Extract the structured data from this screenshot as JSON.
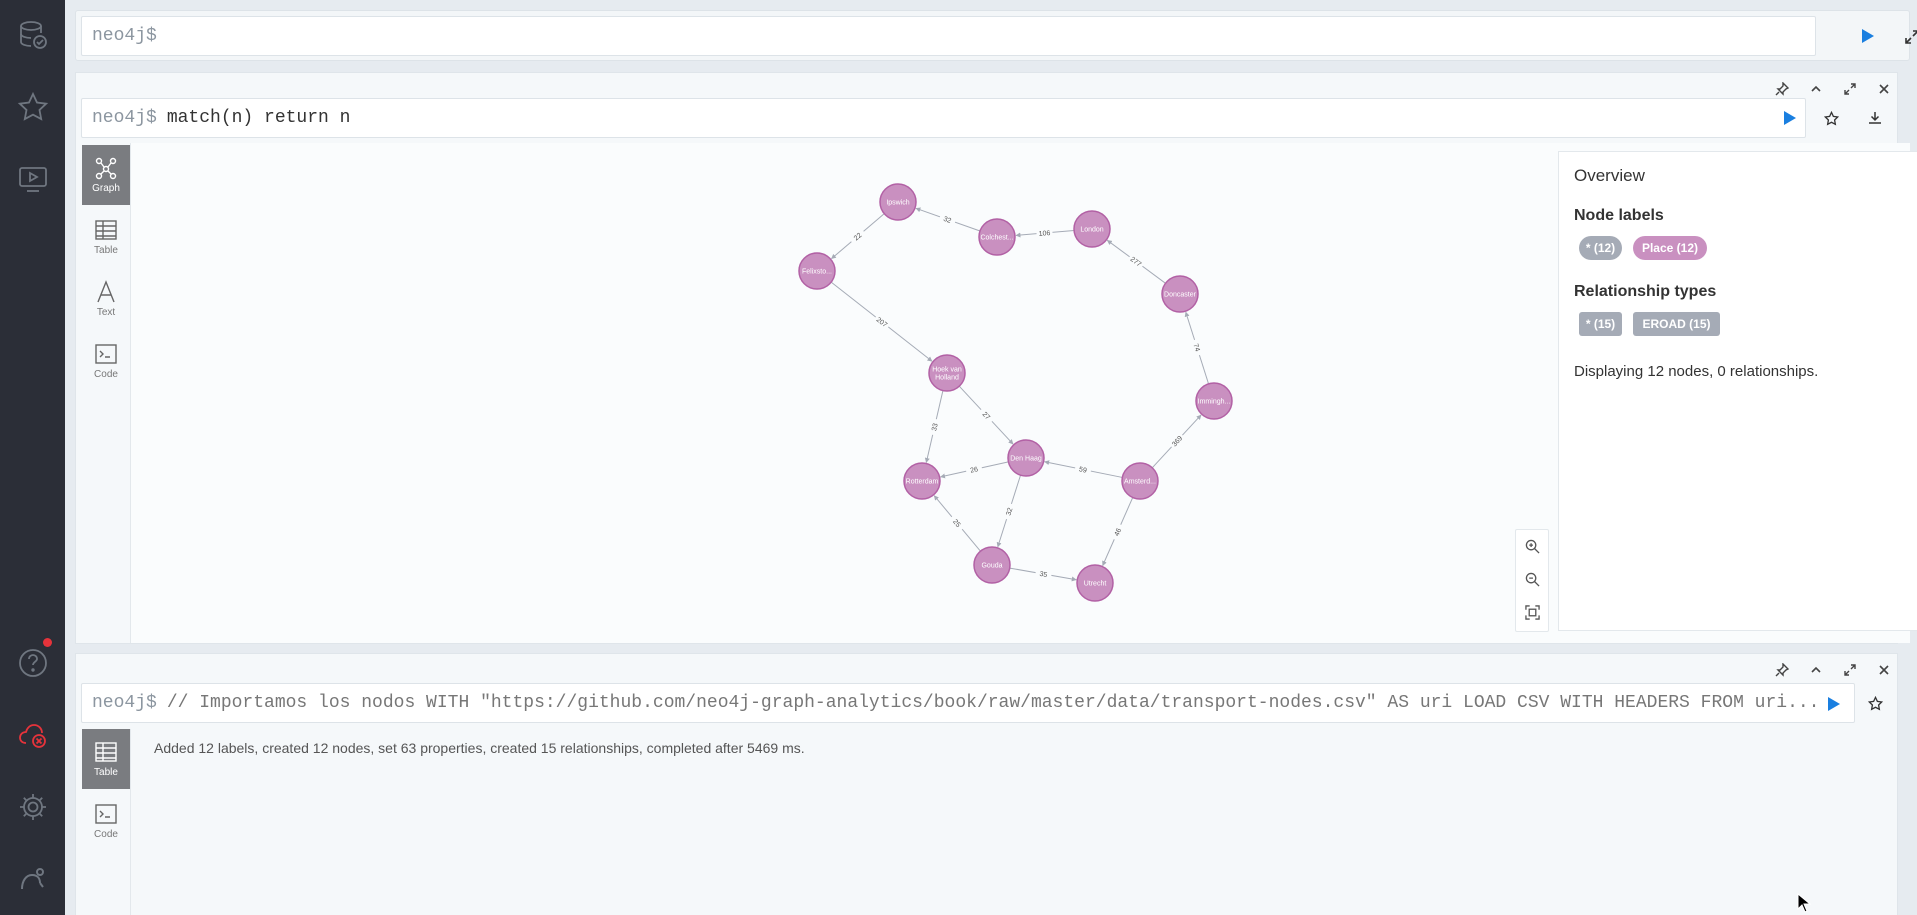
{
  "topbar": {
    "prompt": "neo4j$",
    "query": ""
  },
  "frame1": {
    "prompt": "neo4j$",
    "query": "match(n) return n",
    "tabs": [
      {
        "label": "Graph",
        "icon": "graph-icon",
        "active": true
      },
      {
        "label": "Table",
        "icon": "table-icon",
        "active": false
      },
      {
        "label": "Text",
        "icon": "text-icon",
        "active": false
      },
      {
        "label": "Code",
        "icon": "code-icon",
        "active": false
      }
    ],
    "overview": {
      "title": "Overview",
      "node_labels_title": "Node labels",
      "node_labels": [
        "* (12)",
        "Place (12)"
      ],
      "rel_types_title": "Relationship types",
      "rel_types": [
        "* (15)",
        "EROAD (15)"
      ],
      "status": "Displaying 12 nodes, 0 relationships."
    },
    "graph": {
      "nodes": [
        {
          "id": "ipswich",
          "label": "Ipswich"
        },
        {
          "id": "colchester",
          "label": "Colchest..."
        },
        {
          "id": "london",
          "label": "London"
        },
        {
          "id": "felixstowe",
          "label": "Felixsto..."
        },
        {
          "id": "doncaster",
          "label": "Doncaster"
        },
        {
          "id": "hoek",
          "label": "Hoek van Holland"
        },
        {
          "id": "immingham",
          "label": "Immingh..."
        },
        {
          "id": "denhaag",
          "label": "Den Haag"
        },
        {
          "id": "rotterdam",
          "label": "Rotterdam"
        },
        {
          "id": "amsterdam",
          "label": "Amsterd..."
        },
        {
          "id": "gouda",
          "label": "Gouda"
        },
        {
          "id": "utrecht",
          "label": "Utrecht"
        }
      ],
      "edges": [
        {
          "from": "colchester",
          "to": "ipswich",
          "label": "32"
        },
        {
          "from": "london",
          "to": "colchester",
          "label": "106"
        },
        {
          "from": "ipswich",
          "to": "felixstowe",
          "label": "22"
        },
        {
          "from": "doncaster",
          "to": "london",
          "label": "277"
        },
        {
          "from": "felixstowe",
          "to": "hoek",
          "label": "207"
        },
        {
          "from": "immingham",
          "to": "doncaster",
          "label": "74"
        },
        {
          "from": "hoek",
          "to": "rotterdam",
          "label": "33"
        },
        {
          "from": "hoek",
          "to": "denhaag",
          "label": "27"
        },
        {
          "from": "amsterdam",
          "to": "immingham",
          "label": "369"
        },
        {
          "from": "denhaag",
          "to": "rotterdam",
          "label": "26"
        },
        {
          "from": "amsterdam",
          "to": "denhaag",
          "label": "59"
        },
        {
          "from": "denhaag",
          "to": "gouda",
          "label": "32"
        },
        {
          "from": "amsterdam",
          "to": "utrecht",
          "label": "46"
        },
        {
          "from": "gouda",
          "to": "rotterdam",
          "label": "25"
        },
        {
          "from": "gouda",
          "to": "utrecht",
          "label": "35"
        }
      ]
    }
  },
  "frame2": {
    "prompt": "neo4j$",
    "query": "// Importamos los nodos WITH \"https://github.com/neo4j-graph-analytics/book/raw/master/data/transport-nodes.csv\" AS uri LOAD CSV WITH HEADERS FROM uri...",
    "tabs": [
      {
        "label": "Table",
        "icon": "table-icon",
        "active": true
      },
      {
        "label": "Code",
        "icon": "code-icon",
        "active": false
      }
    ],
    "message": "Added 12 labels, created 12 nodes, set 63 properties, created 15 relationships, completed after 5469 ms."
  },
  "colors": {
    "node": "#c990c0",
    "node_stroke": "#b261a5",
    "pill_gray": "#a5abb6",
    "pill_place": "#c990c0",
    "run": "#1a7fe0"
  }
}
